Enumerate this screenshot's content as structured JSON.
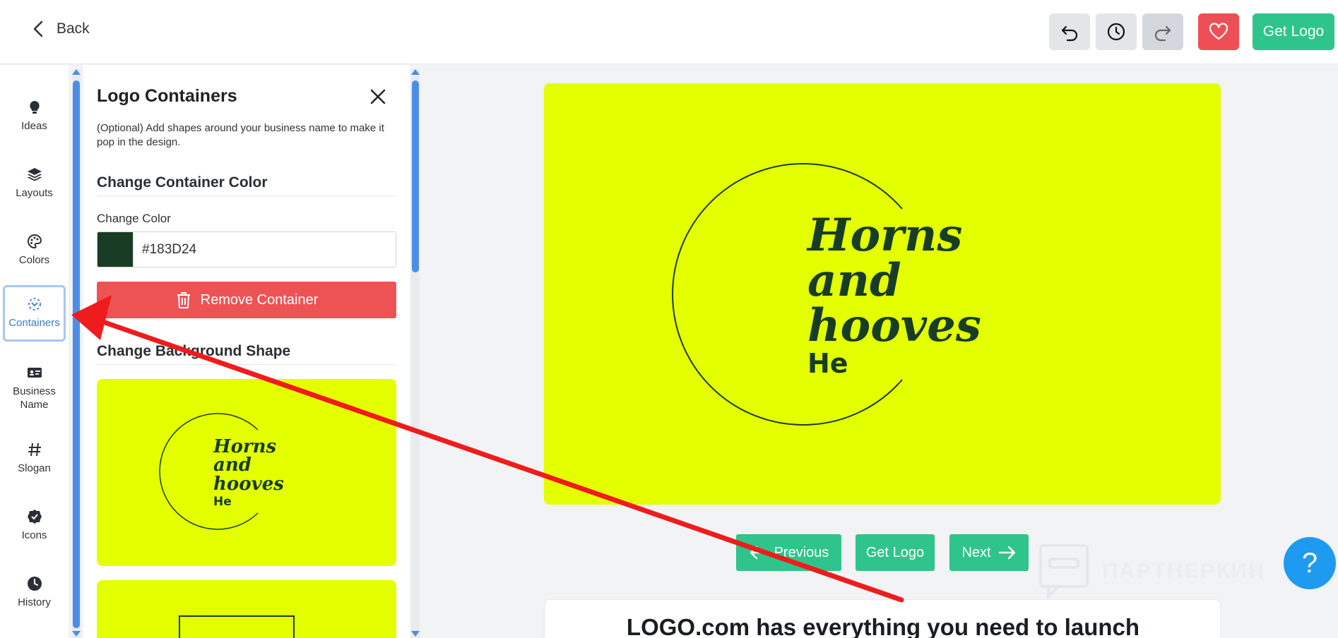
{
  "header": {
    "back_label": "Back",
    "get_logo_label": "Get Logo",
    "undo_icon": "undo-icon",
    "history_icon": "clock-icon",
    "redo_icon": "redo-icon",
    "favorite_icon": "heart-icon"
  },
  "sidebar": {
    "items": [
      {
        "label": "Ideas",
        "icon": "lightbulb-icon"
      },
      {
        "label": "Layouts",
        "icon": "layers-icon"
      },
      {
        "label": "Colors",
        "icon": "palette-icon"
      },
      {
        "label": "Containers",
        "icon": "container-icon",
        "active": true
      },
      {
        "label": "Business Name",
        "icon": "id-card-icon"
      },
      {
        "label": "Slogan",
        "icon": "hash-icon"
      },
      {
        "label": "Icons",
        "icon": "badge-check-icon"
      },
      {
        "label": "History",
        "icon": "clock-icon"
      }
    ]
  },
  "panel": {
    "title": "Logo Containers",
    "description": "(Optional) Add shapes around your business name to make it pop in the design.",
    "section_color": "Change Container Color",
    "change_color_label": "Change Color",
    "color_value": "#183D24",
    "remove_button": "Remove Container",
    "section_shape": "Change Background Shape"
  },
  "logo": {
    "name_line1": "Horns",
    "name_line2": "and",
    "name_line3": "hooves",
    "slogan": "He",
    "background": "#e4ff00",
    "text_color": "#183D24"
  },
  "navigation": {
    "previous": "Previous",
    "get_logo": "Get Logo",
    "next": "Next"
  },
  "promo": {
    "text": "LOGO.com has everything you need to launch"
  },
  "watermark": {
    "text": "ПАРТНЕРКИН"
  },
  "help": {
    "label": "?"
  },
  "colors": {
    "accent_green": "#2fc48b",
    "danger_red": "#ee5354",
    "scroll_blue": "#4c8ee6",
    "help_blue": "#1e9bf0"
  }
}
